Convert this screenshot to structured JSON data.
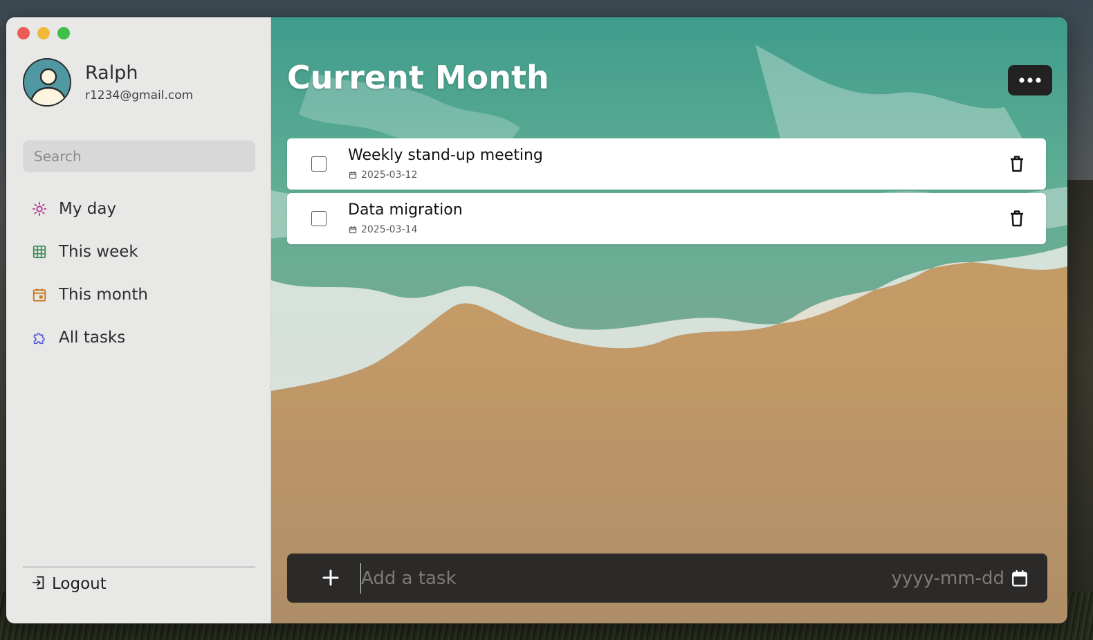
{
  "profile": {
    "name": "Ralph",
    "email": "r1234@gmail.com"
  },
  "search": {
    "placeholder": "Search"
  },
  "nav": {
    "items": [
      {
        "label": "My day",
        "icon": "sun-icon",
        "color": "#b2338f"
      },
      {
        "label": "This week",
        "icon": "grid-icon",
        "color": "#3f8f5a"
      },
      {
        "label": "This month",
        "icon": "calendar-month-icon",
        "color": "#c4771c"
      },
      {
        "label": "All tasks",
        "icon": "puzzle-icon",
        "color": "#5a63d6"
      }
    ]
  },
  "logout": {
    "label": "Logout",
    "icon": "logout-icon"
  },
  "main": {
    "title": "Current Month",
    "more_icon": "more-dots-icon",
    "tasks": [
      {
        "title": "Weekly stand-up meeting",
        "date": "2025-03-12",
        "done": false
      },
      {
        "title": "Data migration",
        "date": "2025-03-14",
        "done": false
      }
    ]
  },
  "add_task": {
    "placeholder": "Add a task",
    "date_placeholder": "yyyy-mm-dd",
    "plus_icon": "plus-icon",
    "calendar_icon": "calendar-icon"
  },
  "colors": {
    "sidebar_bg": "#e8e8e7",
    "add_bar_bg": "#2b2a28",
    "more_button_bg": "#222222",
    "avatar_bg": "#4f98a2"
  }
}
